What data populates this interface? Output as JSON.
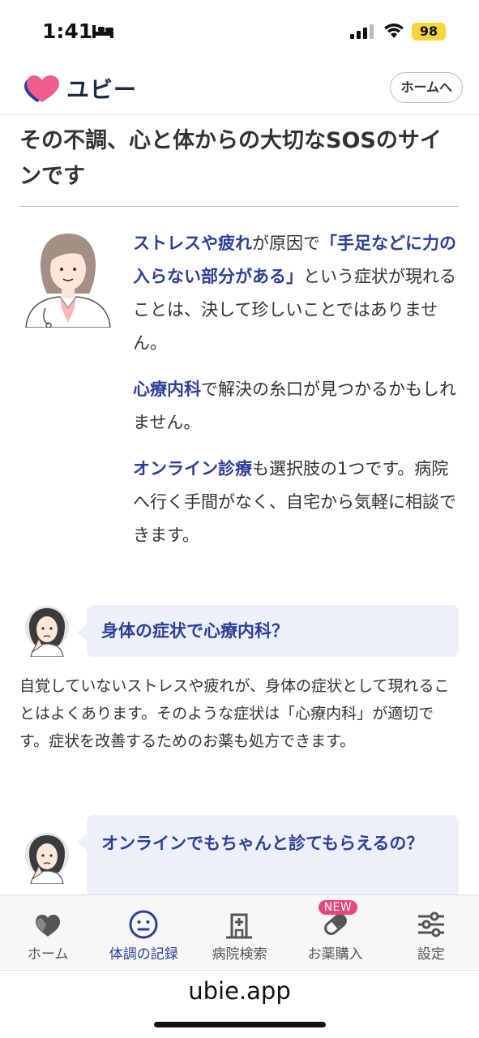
{
  "status_bar": {
    "time": "1:41",
    "battery": "98"
  },
  "header": {
    "logo_text": "ユビー",
    "home_button": "ホームへ"
  },
  "section": {
    "title": "その不調、心と体からの大切なSOSのサインです"
  },
  "intro": {
    "p1": [
      {
        "text": "ストレスや疲れ",
        "hl": true
      },
      {
        "text": "が原因で",
        "hl": false
      },
      {
        "text": "「手足などに力の入らない部分がある」",
        "hl": true
      },
      {
        "text": "という症状が現れることは、決して珍しいことではありません。",
        "hl": false
      }
    ],
    "p2": [
      {
        "text": "心療内科",
        "hl": true
      },
      {
        "text": "で解決の糸口が見つかるかもしれません。",
        "hl": false
      }
    ],
    "p3": [
      {
        "text": "オンライン診療",
        "hl": true
      },
      {
        "text": "も選択肢の1つです。病院へ行く手間がなく、自宅から気軽に相談できます。",
        "hl": false
      }
    ]
  },
  "qa": [
    {
      "question": "身体の症状で心療内科？",
      "answer": "自覚していないストレスや疲れが、身体の症状として現れることはよくあります。そのような症状は「心療内科」が適切です。症状を改善するためのお薬も処方できます。"
    },
    {
      "question": "オンラインでもちゃんと診てもらえるの？",
      "answer": ""
    }
  ],
  "tabs": [
    {
      "label": "ホーム",
      "icon": "heart-logo-icon",
      "active": false
    },
    {
      "label": "体調の記録",
      "icon": "smiley-face-icon",
      "active": true
    },
    {
      "label": "病院検索",
      "icon": "hospital-icon",
      "active": false
    },
    {
      "label": "お薬購入",
      "icon": "pill-icon",
      "active": false,
      "badge": "NEW"
    },
    {
      "label": "設定",
      "icon": "sliders-icon",
      "active": false
    }
  ],
  "browser": {
    "url": "ubie.app"
  },
  "colors": {
    "accent": "#2d3f99",
    "badge": "#e8477b",
    "bubble": "#ecf0fb"
  }
}
